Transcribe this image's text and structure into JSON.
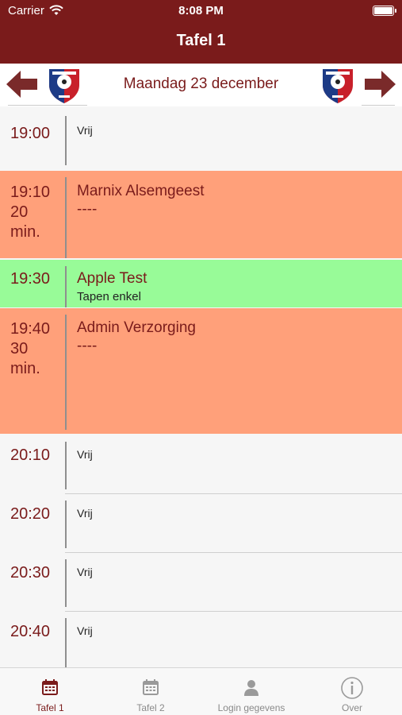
{
  "status_bar": {
    "carrier": "Carrier",
    "time": "8:08 PM"
  },
  "nav": {
    "title": "Tafel 1"
  },
  "date_bar": {
    "date": "Maandag 23 december"
  },
  "colors": {
    "brand": "#7a1b1b",
    "booked": "#ffa07a",
    "highlight": "#98fb98",
    "free": "#f6f6f6"
  },
  "slots": [
    {
      "time": "19:00",
      "label": "Vrij"
    },
    {
      "time": "19:10",
      "duration": "20",
      "unit": "min.",
      "name": "Marnix Alsemgeest",
      "detail": "----"
    },
    {
      "time": "19:30",
      "name": "Apple Test",
      "detail": "Tapen enkel"
    },
    {
      "time": "19:40",
      "duration": "30",
      "unit": "min.",
      "name": "Admin Verzorging",
      "detail": "----"
    },
    {
      "time": "20:10",
      "label": "Vrij"
    },
    {
      "time": "20:20",
      "label": "Vrij"
    },
    {
      "time": "20:30",
      "label": "Vrij"
    },
    {
      "time": "20:40",
      "label": "Vrij"
    }
  ],
  "tabs": [
    {
      "label": "Tafel 1",
      "icon": "calendar-icon",
      "active": true
    },
    {
      "label": "Tafel 2",
      "icon": "calendar-icon",
      "active": false
    },
    {
      "label": "Login gegevens",
      "icon": "person-icon",
      "active": false
    },
    {
      "label": "Over",
      "icon": "info-icon",
      "active": false
    }
  ]
}
